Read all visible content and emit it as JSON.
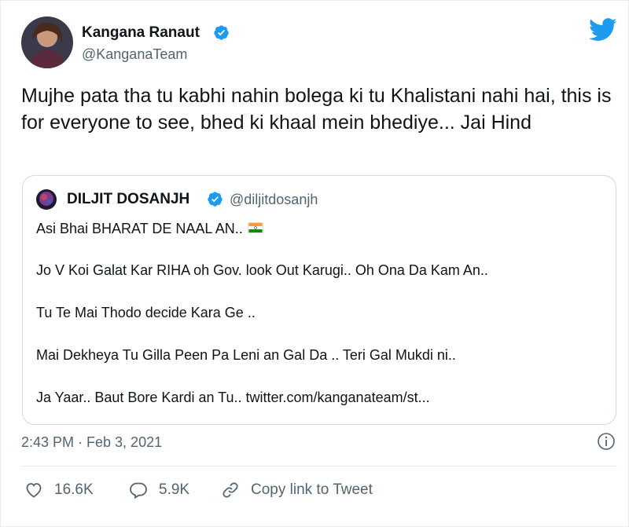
{
  "tweet": {
    "author": {
      "name": "Kangana Ranaut",
      "handle": "@KanganaTeam",
      "verified_icon": "verified-badge-icon"
    },
    "brand_icon": "twitter-bird-icon",
    "text": "Mujhe pata tha tu kabhi nahin bolega ki tu Khalistani nahi hai, this is for everyone to see, bhed ki khaal mein bhediye... Jai Hind",
    "quoted": {
      "name": "DILJIT DOSANJH",
      "handle": "@diljitdosanjh",
      "lines": [
        "Asi Bhai BHARAT DE NAAL AN..",
        "Jo V Koi Galat Kar RIHA oh Gov. look Out Karugi.. Oh Ona Da Kam An..",
        "Tu Te Mai Thodo decide Kara Ge ..",
        "Mai Dekheya Tu Gilla Peen Pa Leni an Gal Da .. Teri Gal Mukdi ni..",
        "Ja Yaar.. Baut Bore Kardi an Tu.. twitter.com/kanganateam/st..."
      ],
      "flag_icon": "india-flag-icon"
    },
    "timestamp": "2:43 PM · Feb 3, 2021",
    "actions": {
      "likes": "16.6K",
      "replies": "5.9K",
      "copy_link": "Copy link to Tweet"
    }
  },
  "colors": {
    "brand_blue": "#1d9bf0",
    "text_primary": "#0f1419",
    "text_secondary": "#536471",
    "border": "#cfd9de"
  }
}
